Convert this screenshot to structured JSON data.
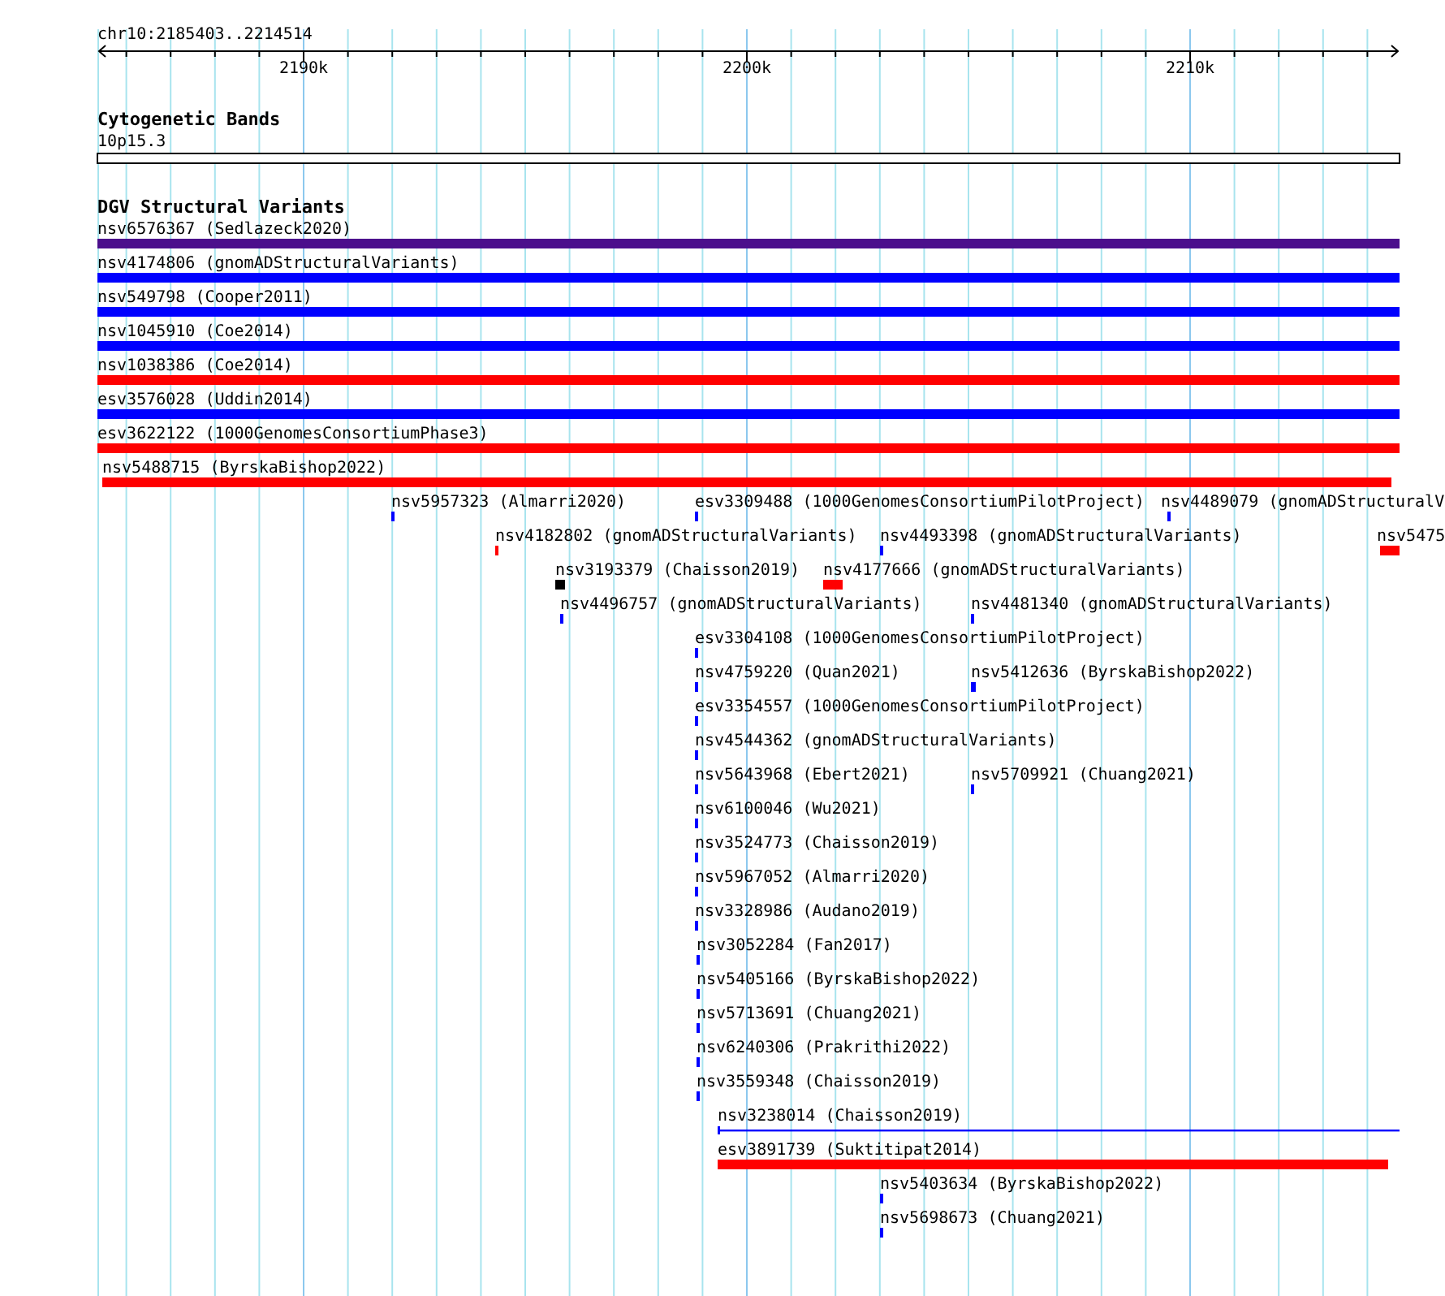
{
  "ruler": {
    "position": "chr10:2185403..2214514",
    "tick_labels": [
      "2190k",
      "2200k",
      "2210k"
    ]
  },
  "tracks": [
    {
      "kind": "bands",
      "title": "Cytogenetic Bands",
      "band_label": "10p15.3"
    },
    {
      "kind": "features",
      "title": "DGV Structural Variants",
      "features": [
        {
          "label": "nsv6576367 (Sedlazeck2020)",
          "color": "#4b0f8c"
        },
        {
          "label": "nsv4174806 (gnomADStructuralVariants)",
          "color": "#0000ff"
        },
        {
          "label": "nsv549798 (Cooper2011)",
          "color": "#0000ff"
        },
        {
          "label": "nsv1045910 (Coe2014)",
          "color": "#0000ff"
        },
        {
          "label": "nsv1038386 (Coe2014)",
          "color": "#ff0000"
        },
        {
          "label": "esv3576028 (Uddin2014)",
          "color": "#0000ff"
        },
        {
          "label": "esv3622122 (1000GenomesConsortiumPhase3)",
          "color": "#ff0000"
        },
        {
          "label": "nsv5488715 (ByrskaBishop2022)",
          "color": "#ff0000"
        },
        {
          "label": "nsv5957323 (Almarri2020)",
          "color": "#0000ff"
        },
        {
          "label": "esv3309488 (1000GenomesConsortiumPilotProject)",
          "color": "#0000ff"
        },
        {
          "label": "nsv4489079 (gnomADStructuralV",
          "color": "#0000ff"
        },
        {
          "label": "nsv4182802 (gnomADStructuralVariants)",
          "color": "#ff0000"
        },
        {
          "label": "nsv4493398 (gnomADStructuralVariants)",
          "color": "#0000ff"
        },
        {
          "label": "nsv5475",
          "color": "#ff0000"
        },
        {
          "label": "nsv3193379 (Chaisson2019)",
          "color": "#000000"
        },
        {
          "label": "nsv4177666 (gnomADStructuralVariants)",
          "color": "#ff0000"
        },
        {
          "label": "nsv4496757 (gnomADStructuralVariants)",
          "color": "#0000ff"
        },
        {
          "label": "nsv4481340 (gnomADStructuralVariants)",
          "color": "#0000ff"
        },
        {
          "label": "esv3304108 (1000GenomesConsortiumPilotProject)",
          "color": "#0000ff"
        },
        {
          "label": "nsv4759220 (Quan2021)",
          "color": "#0000ff"
        },
        {
          "label": "nsv5412636 (ByrskaBishop2022)",
          "color": "#0000ff"
        },
        {
          "label": "esv3354557 (1000GenomesConsortiumPilotProject)",
          "color": "#0000ff"
        },
        {
          "label": "nsv4544362 (gnomADStructuralVariants)",
          "color": "#0000ff"
        },
        {
          "label": "nsv5643968 (Ebert2021)",
          "color": "#0000ff"
        },
        {
          "label": "nsv5709921 (Chuang2021)",
          "color": "#0000ff"
        },
        {
          "label": "nsv6100046 (Wu2021)",
          "color": "#0000ff"
        },
        {
          "label": "nsv3524773 (Chaisson2019)",
          "color": "#0000ff"
        },
        {
          "label": "nsv5967052 (Almarri2020)",
          "color": "#0000ff"
        },
        {
          "label": "nsv3328986 (Audano2019)",
          "color": "#0000ff"
        },
        {
          "label": "nsv3052284 (Fan2017)",
          "color": "#0000ff"
        },
        {
          "label": "nsv5405166 (ByrskaBishop2022)",
          "color": "#0000ff"
        },
        {
          "label": "nsv5713691 (Chuang2021)",
          "color": "#0000ff"
        },
        {
          "label": "nsv6240306 (Prakrithi2022)",
          "color": "#0000ff"
        },
        {
          "label": "nsv3559348 (Chaisson2019)",
          "color": "#0000ff"
        },
        {
          "label": "nsv3238014 (Chaisson2019)",
          "color": "#0000ff"
        },
        {
          "label": "esv3891739 (Suktitipat2014)",
          "color": "#ff0000"
        },
        {
          "label": "nsv5403634 (ByrskaBishop2022)",
          "color": "#0000ff"
        },
        {
          "label": "nsv5698673 (Chuang2021)",
          "color": "#0000ff"
        }
      ]
    }
  ]
}
